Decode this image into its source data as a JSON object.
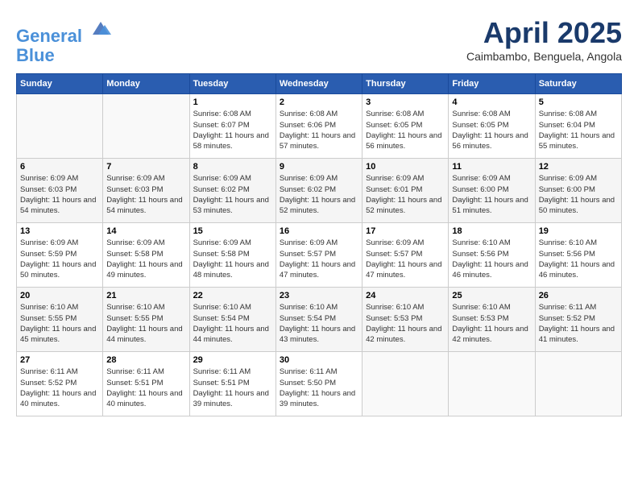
{
  "header": {
    "logo_line1": "General",
    "logo_line2": "Blue",
    "title": "April 2025",
    "location": "Caimbambo, Benguela, Angola"
  },
  "weekdays": [
    "Sunday",
    "Monday",
    "Tuesday",
    "Wednesday",
    "Thursday",
    "Friday",
    "Saturday"
  ],
  "weeks": [
    [
      {
        "day": "",
        "info": ""
      },
      {
        "day": "",
        "info": ""
      },
      {
        "day": "1",
        "info": "Sunrise: 6:08 AM\nSunset: 6:07 PM\nDaylight: 11 hours and 58 minutes."
      },
      {
        "day": "2",
        "info": "Sunrise: 6:08 AM\nSunset: 6:06 PM\nDaylight: 11 hours and 57 minutes."
      },
      {
        "day": "3",
        "info": "Sunrise: 6:08 AM\nSunset: 6:05 PM\nDaylight: 11 hours and 56 minutes."
      },
      {
        "day": "4",
        "info": "Sunrise: 6:08 AM\nSunset: 6:05 PM\nDaylight: 11 hours and 56 minutes."
      },
      {
        "day": "5",
        "info": "Sunrise: 6:08 AM\nSunset: 6:04 PM\nDaylight: 11 hours and 55 minutes."
      }
    ],
    [
      {
        "day": "6",
        "info": "Sunrise: 6:09 AM\nSunset: 6:03 PM\nDaylight: 11 hours and 54 minutes."
      },
      {
        "day": "7",
        "info": "Sunrise: 6:09 AM\nSunset: 6:03 PM\nDaylight: 11 hours and 54 minutes."
      },
      {
        "day": "8",
        "info": "Sunrise: 6:09 AM\nSunset: 6:02 PM\nDaylight: 11 hours and 53 minutes."
      },
      {
        "day": "9",
        "info": "Sunrise: 6:09 AM\nSunset: 6:02 PM\nDaylight: 11 hours and 52 minutes."
      },
      {
        "day": "10",
        "info": "Sunrise: 6:09 AM\nSunset: 6:01 PM\nDaylight: 11 hours and 52 minutes."
      },
      {
        "day": "11",
        "info": "Sunrise: 6:09 AM\nSunset: 6:00 PM\nDaylight: 11 hours and 51 minutes."
      },
      {
        "day": "12",
        "info": "Sunrise: 6:09 AM\nSunset: 6:00 PM\nDaylight: 11 hours and 50 minutes."
      }
    ],
    [
      {
        "day": "13",
        "info": "Sunrise: 6:09 AM\nSunset: 5:59 PM\nDaylight: 11 hours and 50 minutes."
      },
      {
        "day": "14",
        "info": "Sunrise: 6:09 AM\nSunset: 5:58 PM\nDaylight: 11 hours and 49 minutes."
      },
      {
        "day": "15",
        "info": "Sunrise: 6:09 AM\nSunset: 5:58 PM\nDaylight: 11 hours and 48 minutes."
      },
      {
        "day": "16",
        "info": "Sunrise: 6:09 AM\nSunset: 5:57 PM\nDaylight: 11 hours and 47 minutes."
      },
      {
        "day": "17",
        "info": "Sunrise: 6:09 AM\nSunset: 5:57 PM\nDaylight: 11 hours and 47 minutes."
      },
      {
        "day": "18",
        "info": "Sunrise: 6:10 AM\nSunset: 5:56 PM\nDaylight: 11 hours and 46 minutes."
      },
      {
        "day": "19",
        "info": "Sunrise: 6:10 AM\nSunset: 5:56 PM\nDaylight: 11 hours and 46 minutes."
      }
    ],
    [
      {
        "day": "20",
        "info": "Sunrise: 6:10 AM\nSunset: 5:55 PM\nDaylight: 11 hours and 45 minutes."
      },
      {
        "day": "21",
        "info": "Sunrise: 6:10 AM\nSunset: 5:55 PM\nDaylight: 11 hours and 44 minutes."
      },
      {
        "day": "22",
        "info": "Sunrise: 6:10 AM\nSunset: 5:54 PM\nDaylight: 11 hours and 44 minutes."
      },
      {
        "day": "23",
        "info": "Sunrise: 6:10 AM\nSunset: 5:54 PM\nDaylight: 11 hours and 43 minutes."
      },
      {
        "day": "24",
        "info": "Sunrise: 6:10 AM\nSunset: 5:53 PM\nDaylight: 11 hours and 42 minutes."
      },
      {
        "day": "25",
        "info": "Sunrise: 6:10 AM\nSunset: 5:53 PM\nDaylight: 11 hours and 42 minutes."
      },
      {
        "day": "26",
        "info": "Sunrise: 6:11 AM\nSunset: 5:52 PM\nDaylight: 11 hours and 41 minutes."
      }
    ],
    [
      {
        "day": "27",
        "info": "Sunrise: 6:11 AM\nSunset: 5:52 PM\nDaylight: 11 hours and 40 minutes."
      },
      {
        "day": "28",
        "info": "Sunrise: 6:11 AM\nSunset: 5:51 PM\nDaylight: 11 hours and 40 minutes."
      },
      {
        "day": "29",
        "info": "Sunrise: 6:11 AM\nSunset: 5:51 PM\nDaylight: 11 hours and 39 minutes."
      },
      {
        "day": "30",
        "info": "Sunrise: 6:11 AM\nSunset: 5:50 PM\nDaylight: 11 hours and 39 minutes."
      },
      {
        "day": "",
        "info": ""
      },
      {
        "day": "",
        "info": ""
      },
      {
        "day": "",
        "info": ""
      }
    ]
  ]
}
